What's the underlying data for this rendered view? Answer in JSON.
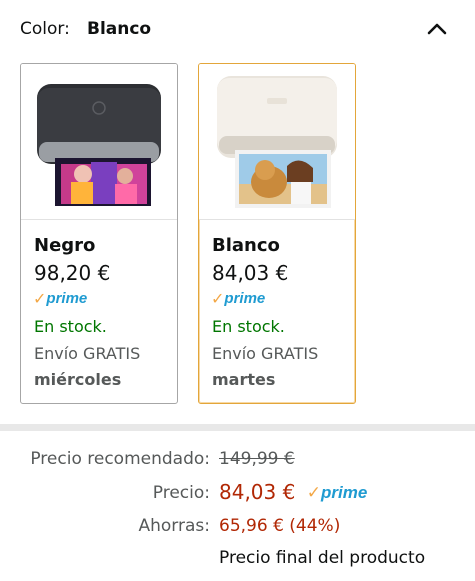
{
  "color_selector": {
    "label": "Color:",
    "selected_value": "Blanco",
    "expanded": true
  },
  "swatches": [
    {
      "name": "Negro",
      "price": "98,20 €",
      "prime_check": "✓",
      "prime_word": "prime",
      "stock": "En stock.",
      "shipping": "Envío GRATIS",
      "delivery_day": "miércoles",
      "selected": false
    },
    {
      "name": "Blanco",
      "price": "84,03 €",
      "prime_check": "✓",
      "prime_word": "prime",
      "stock": "En stock.",
      "shipping": "Envío GRATIS",
      "delivery_day": "martes",
      "selected": true
    }
  ],
  "pricing": {
    "recommended_label": "Precio recomendado:",
    "recommended_value": "149,99 €",
    "price_label": "Precio:",
    "price_value": "84,03 €",
    "prime_check": "✓",
    "prime_word": "prime",
    "savings_label": "Ahorras:",
    "savings_value": "65,96 € (44%)",
    "final_note": "Precio final del producto"
  },
  "colors": {
    "selected_border": "#e3a63a",
    "prime_blue": "#1f9bd1",
    "prime_orange": "#f3a847",
    "stock_green": "#007600",
    "price_red": "#b12704"
  }
}
